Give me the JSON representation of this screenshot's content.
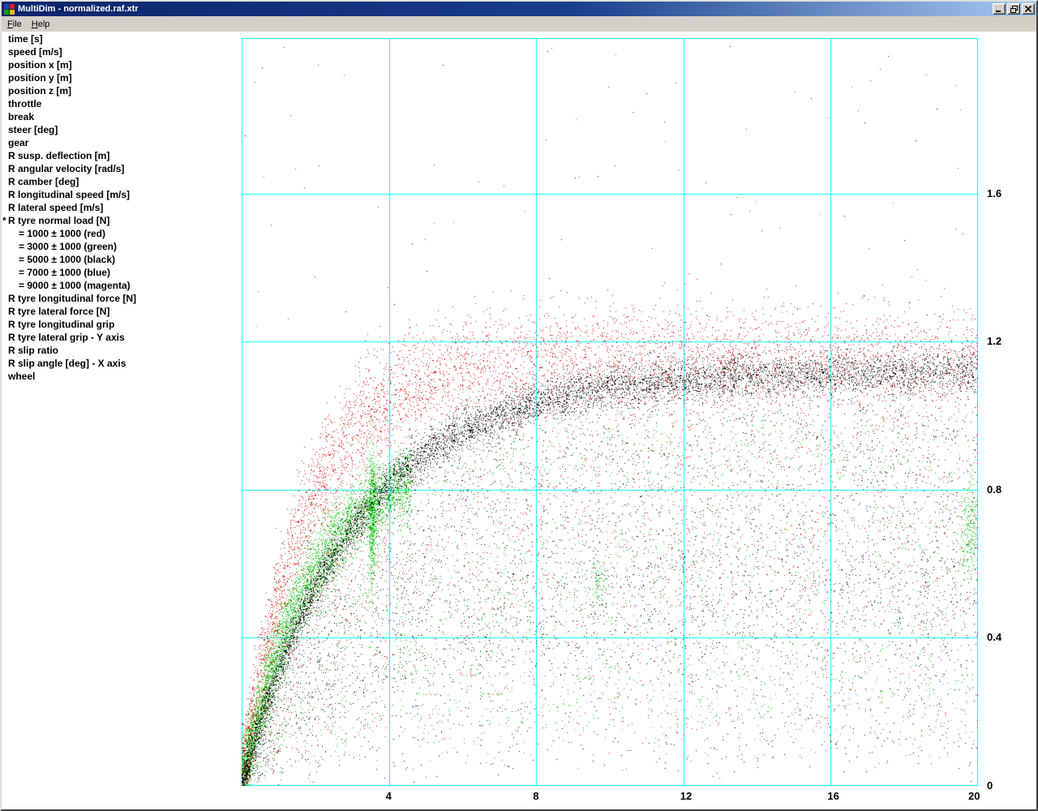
{
  "window": {
    "title": "MultiDim - normalized.raf.xtr",
    "controls": [
      {
        "name": "minimize",
        "glyph": "minimize-icon"
      },
      {
        "name": "restore",
        "glyph": "restore-icon"
      },
      {
        "name": "close",
        "glyph": "close-icon"
      }
    ]
  },
  "menu": {
    "items": [
      {
        "label": "File"
      },
      {
        "label": "Help"
      }
    ]
  },
  "sidebar": {
    "items": [
      {
        "text": "time [s]"
      },
      {
        "text": "speed [m/s]"
      },
      {
        "text": "position x [m]"
      },
      {
        "text": "position y [m]"
      },
      {
        "text": "position z [m]"
      },
      {
        "text": "throttle"
      },
      {
        "text": "break"
      },
      {
        "text": "steer [deg]"
      },
      {
        "text": "gear"
      },
      {
        "text": "R susp. deflection [m]"
      },
      {
        "text": "R angular velocity [rad/s]"
      },
      {
        "text": "R camber [deg]"
      },
      {
        "text": "R longitudinal speed [m/s]"
      },
      {
        "text": "R lateral speed [m/s]"
      },
      {
        "text": "R tyre normal load [N]",
        "star": true
      },
      {
        "text": "= 1000 ± 1000 (red)",
        "indent": 1,
        "legend_color": "#dd0000"
      },
      {
        "text": "= 3000 ± 1000 (green)",
        "indent": 1,
        "legend_color": "#00c300"
      },
      {
        "text": "= 5000 ± 1000 (black)",
        "indent": 1,
        "legend_color": "#000000"
      },
      {
        "text": "= 7000 ± 1000 (blue)",
        "indent": 1,
        "legend_color": "#0000ff"
      },
      {
        "text": "= 9000 ± 1000 (magenta)",
        "indent": 1,
        "legend_color": "#ff00ff"
      },
      {
        "text": "R tyre longitudinal force [N]"
      },
      {
        "text": "R tyre lateral force [N]"
      },
      {
        "text": "R tyre longitudinal grip"
      },
      {
        "text": "R tyre lateral grip - Y axis"
      },
      {
        "text": "R slip ratio"
      },
      {
        "text": "R slip angle [deg] - X axis"
      },
      {
        "text": "wheel"
      }
    ]
  },
  "chart_data": {
    "type": "scatter",
    "title": "",
    "xlabel": "R slip angle [deg]",
    "ylabel": "R tyre lateral grip",
    "xlim": [
      0,
      20
    ],
    "ylim": [
      0,
      2.02
    ],
    "x_ticks": [
      4,
      8,
      12,
      16,
      20
    ],
    "y_ticks": [
      0,
      0.4,
      0.8,
      1.2,
      1.6
    ],
    "grid": true,
    "grid_color": "#00ffff",
    "seed": 1337,
    "series": [
      {
        "name": "R tyre normal load = 1000 ± 1000 N (red)",
        "color": "#dd0000",
        "n": 8000,
        "peak": 1.16,
        "rise": 1.7,
        "stray_n": 45,
        "components": [
          {
            "frac": 0.55,
            "mode": "band",
            "sigma": 0.07,
            "x_pow": 1.5,
            "x_max": 20
          },
          {
            "frac": 0.35,
            "mode": "cloud",
            "lo": 0.45,
            "hi": 1.03,
            "sigma": 0.05,
            "x_pow": 1.2,
            "x_max": 20
          },
          {
            "frac": 0.1,
            "mode": "cloud",
            "lo": 0.08,
            "hi": 0.5,
            "sigma": 0.04,
            "x_pow": 0.9,
            "x_max": 20
          }
        ]
      },
      {
        "name": "R tyre normal load = 3000 ± 1000 N (green)",
        "color": "#00c300",
        "n": 7000,
        "peak": 0.9,
        "rise": 1.9,
        "stray_n": 25,
        "components": [
          {
            "frac": 0.55,
            "mode": "band",
            "sigma": 0.05,
            "x_pow": 1.4,
            "x_max": 4.6
          },
          {
            "frac": 0.12,
            "mode": "band",
            "sigma": 0.06,
            "x_pow": 1.0,
            "x_max": 20
          },
          {
            "frac": 0.33,
            "mode": "cloud",
            "lo": 0.15,
            "hi": 0.85,
            "sigma": 0.05,
            "x_pow": 1.0,
            "x_max": 20
          }
        ]
      },
      {
        "name": "R tyre normal load = 5000 ± 1000 N (black)",
        "color": "#000000",
        "n": 10000,
        "peak": 1.12,
        "rise": 3.1,
        "stray_n": 30,
        "components": [
          {
            "frac": 0.62,
            "mode": "band",
            "sigma": 0.028,
            "x_pow": 1.35,
            "x_max": 20
          },
          {
            "frac": 0.3,
            "mode": "cloud",
            "lo": 0.3,
            "hi": 1.05,
            "sigma": 0.04,
            "x_pow": 1.1,
            "x_max": 20
          },
          {
            "frac": 0.08,
            "mode": "cloud",
            "lo": 0.05,
            "hi": 0.55,
            "sigma": 0.03,
            "x_pow": 0.8,
            "x_max": 20
          }
        ]
      },
      {
        "name": "R tyre normal load = 7000 ± 1000 N (blue)",
        "color": "#0000ff",
        "n": 0,
        "peak": 1.0,
        "rise": 3.0,
        "stray_n": 0,
        "components": []
      },
      {
        "name": "R tyre normal load = 9000 ± 1000 N (magenta)",
        "color": "#ff00ff",
        "n": 0,
        "peak": 1.0,
        "rise": 3.0,
        "stray_n": 0,
        "components": []
      }
    ],
    "clusters": [
      {
        "color": "#00c300",
        "x": 3.55,
        "y": 0.72,
        "sx": 0.05,
        "sy": 0.1,
        "n": 500
      },
      {
        "color": "#00c300",
        "x": 19.8,
        "y": 0.7,
        "sx": 0.15,
        "sy": 0.07,
        "n": 260
      },
      {
        "color": "#00c300",
        "x": 9.7,
        "y": 0.55,
        "sx": 0.1,
        "sy": 0.03,
        "n": 70
      }
    ]
  }
}
